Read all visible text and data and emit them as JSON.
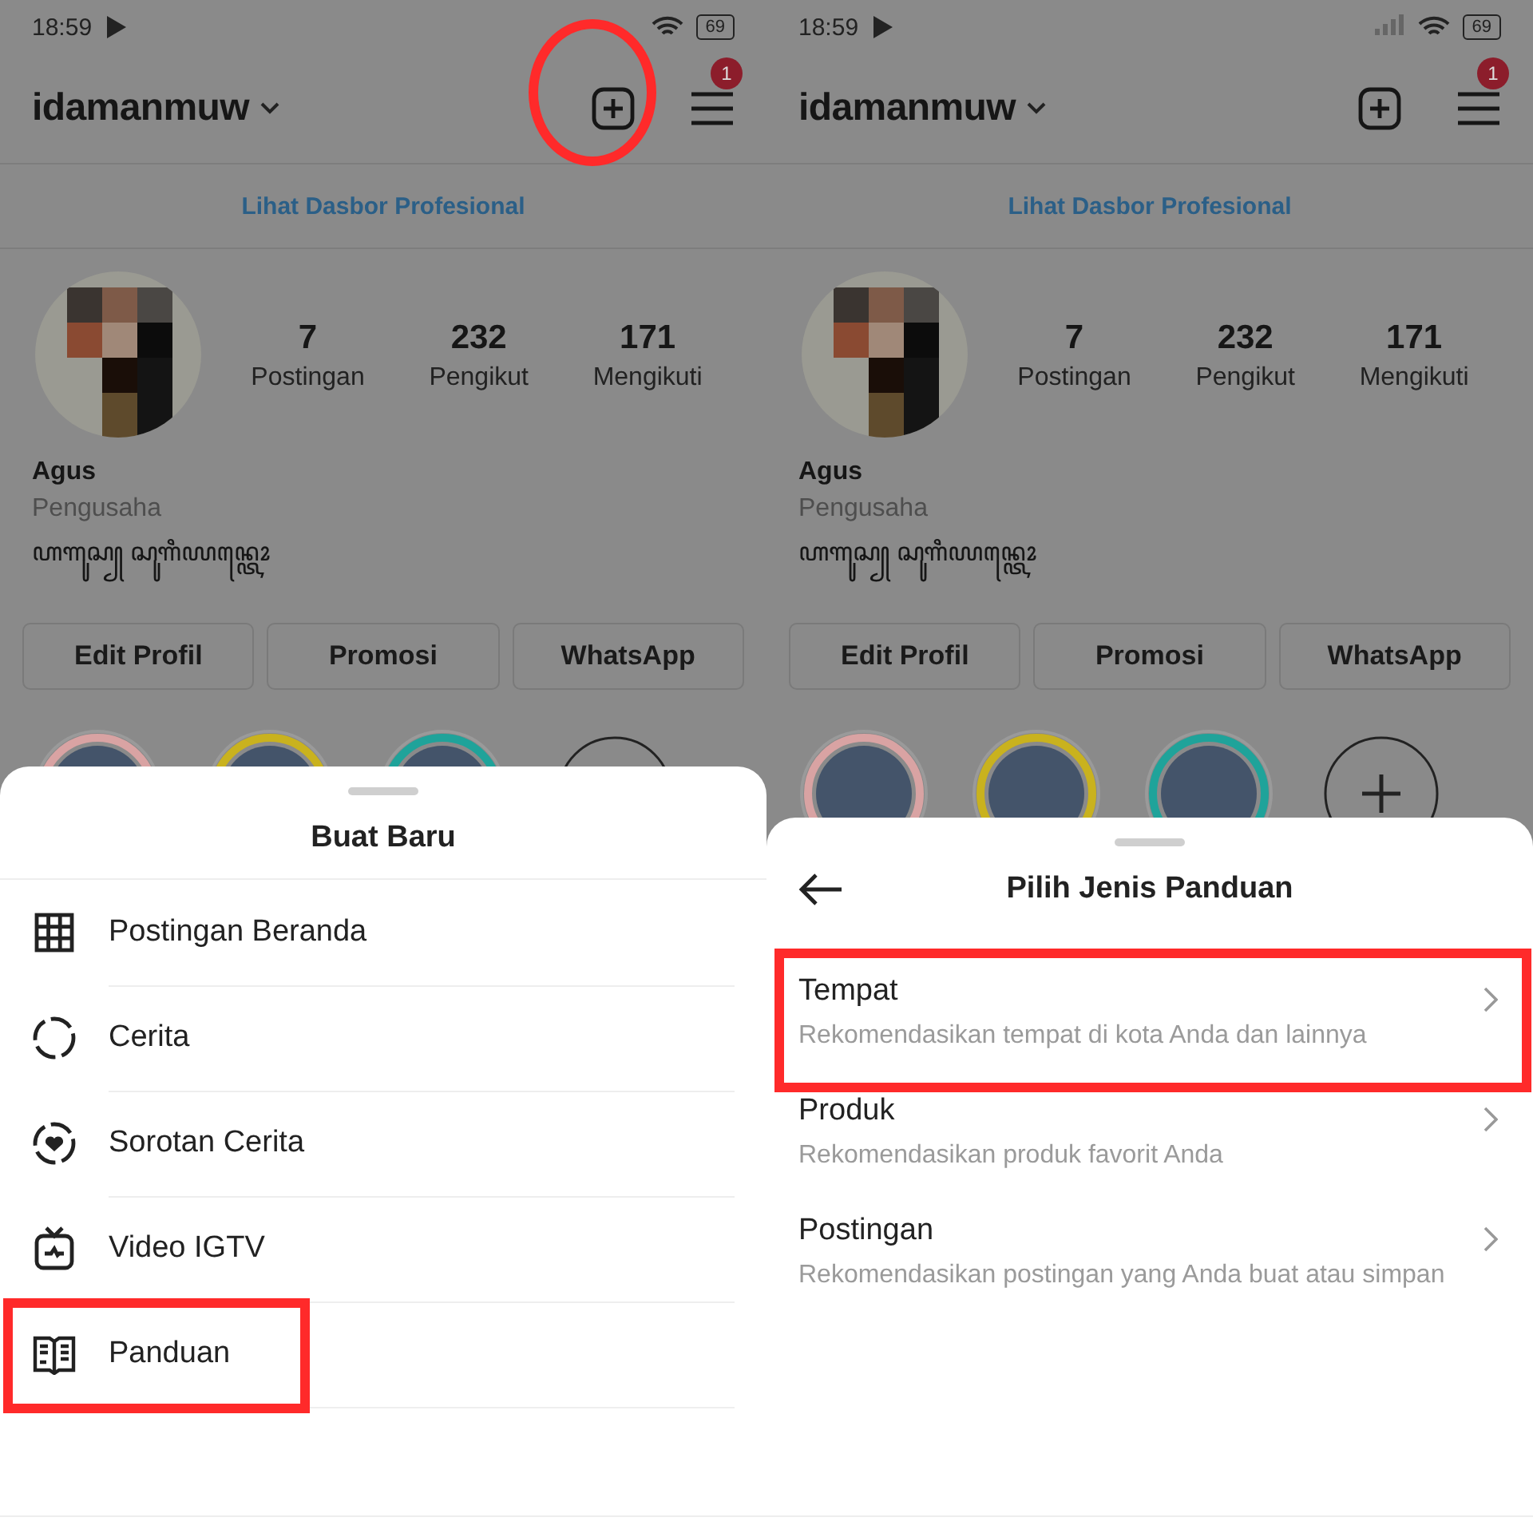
{
  "screens": [
    {
      "status": {
        "time": "18:59",
        "battery": "69",
        "signal": false
      },
      "header": {
        "username": "idamanmuw",
        "badge": "1",
        "plus_circled": true
      },
      "dashboard_link": "Lihat Dasbor Profesional",
      "stats": [
        {
          "value": "7",
          "label": "Postingan"
        },
        {
          "value": "232",
          "label": "Pengikut"
        },
        {
          "value": "171",
          "label": "Mengikuti"
        }
      ],
      "name": "Agus",
      "category": "Pengusaha",
      "bio": "ꦲꦒꦸꦱ꧀ ꦱꦸꦒꦶꦪꦤ꧀ꦠꦺꦴ",
      "buttons": [
        "Edit Profil",
        "Promosi",
        "WhatsApp"
      ],
      "highlights": [
        {
          "kind": "cover",
          "color": "#d9a3a3"
        },
        {
          "kind": "cover",
          "color": "#c9b21e"
        },
        {
          "kind": "cover",
          "color": "#1fa39a"
        },
        {
          "kind": "add"
        }
      ],
      "sheet": {
        "kind": "menu",
        "title": "Buat Baru",
        "items": [
          {
            "kind": "grid",
            "label": "Postingan Beranda",
            "highlighted": false
          },
          {
            "kind": "story",
            "label": "Cerita",
            "highlighted": false
          },
          {
            "kind": "highlight",
            "label": "Sorotan Cerita",
            "highlighted": false
          },
          {
            "kind": "tv",
            "label": "Video IGTV",
            "highlighted": false
          },
          {
            "kind": "guide",
            "label": "Panduan",
            "highlighted": true
          }
        ]
      }
    },
    {
      "status": {
        "time": "18:59",
        "battery": "69",
        "signal": true
      },
      "header": {
        "username": "idamanmuw",
        "badge": "1",
        "plus_circled": false
      },
      "dashboard_link": "Lihat Dasbor Profesional",
      "stats": [
        {
          "value": "7",
          "label": "Postingan"
        },
        {
          "value": "232",
          "label": "Pengikut"
        },
        {
          "value": "171",
          "label": "Mengikuti"
        }
      ],
      "name": "Agus",
      "category": "Pengusaha",
      "bio": "ꦲꦒꦸꦱ꧀ ꦱꦸꦒꦶꦪꦤ꧀ꦠꦺꦴ",
      "buttons": [
        "Edit Profil",
        "Promosi",
        "WhatsApp"
      ],
      "highlights": [
        {
          "kind": "cover",
          "color": "#d9a3a3"
        },
        {
          "kind": "cover",
          "color": "#c9b21e"
        },
        {
          "kind": "cover",
          "color": "#1fa39a"
        },
        {
          "kind": "add"
        }
      ],
      "sheet": {
        "kind": "guide",
        "title": "Pilih Jenis Panduan",
        "items": [
          {
            "title": "Tempat",
            "subtitle": "Rekomendasikan tempat di kota Anda dan lainnya",
            "highlighted": true
          },
          {
            "title": "Produk",
            "subtitle": "Rekomendasikan produk favorit Anda",
            "highlighted": false
          },
          {
            "title": "Postingan",
            "subtitle": "Rekomendasikan postingan yang Anda buat atau simpan",
            "highlighted": false
          }
        ]
      }
    }
  ]
}
